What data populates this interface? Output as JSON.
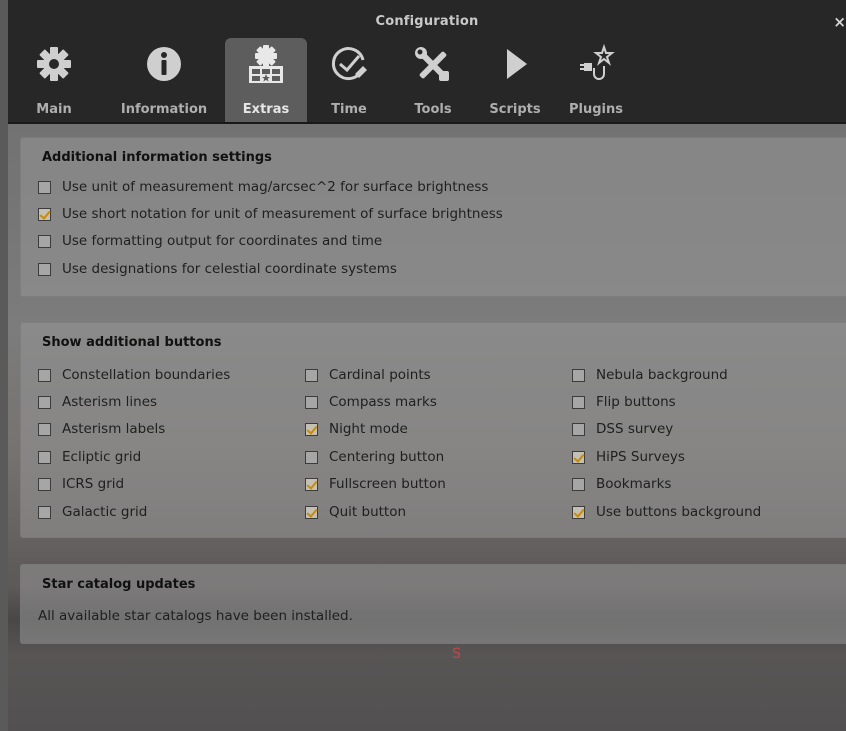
{
  "window": {
    "title": "Configuration",
    "close_label": "×"
  },
  "tabs": [
    {
      "label": "Main",
      "icon": "gear-icon",
      "active": false
    },
    {
      "label": "Information",
      "icon": "info-icon",
      "active": false
    },
    {
      "label": "Extras",
      "icon": "extras-icon",
      "active": true
    },
    {
      "label": "Time",
      "icon": "clock-icon",
      "active": false
    },
    {
      "label": "Tools",
      "icon": "tools-icon",
      "active": false
    },
    {
      "label": "Scripts",
      "icon": "play-icon",
      "active": false
    },
    {
      "label": "Plugins",
      "icon": "plugin-icon",
      "active": false
    }
  ],
  "additional_info": {
    "title": "Additional information settings",
    "options": [
      {
        "label": "Use unit of measurement mag/arcsec^2 for surface brightness",
        "checked": false
      },
      {
        "label": "Use short notation for unit of measurement of surface brightness",
        "checked": true
      },
      {
        "label": "Use formatting output for coordinates and time",
        "checked": false
      },
      {
        "label": "Use designations for celestial coordinate systems",
        "checked": false
      }
    ]
  },
  "buttons_group": {
    "title": "Show additional buttons",
    "col1": [
      {
        "label": "Constellation boundaries",
        "checked": false
      },
      {
        "label": "Asterism lines",
        "checked": false
      },
      {
        "label": "Asterism labels",
        "checked": false
      },
      {
        "label": "Ecliptic grid",
        "checked": false
      },
      {
        "label": "ICRS grid",
        "checked": false
      },
      {
        "label": "Galactic grid",
        "checked": false
      }
    ],
    "col2": [
      {
        "label": "Cardinal points",
        "checked": false
      },
      {
        "label": "Compass marks",
        "checked": false
      },
      {
        "label": "Night mode",
        "checked": true
      },
      {
        "label": "Centering button",
        "checked": false
      },
      {
        "label": "Fullscreen button",
        "checked": true
      },
      {
        "label": "Quit button",
        "checked": true
      }
    ],
    "col3": [
      {
        "label": "Nebula background",
        "checked": false
      },
      {
        "label": "Flip buttons",
        "checked": false
      },
      {
        "label": "DSS survey",
        "checked": false
      },
      {
        "label": "HiPS Surveys",
        "checked": true
      },
      {
        "label": "Bookmarks",
        "checked": false
      },
      {
        "label": "Use buttons background",
        "checked": true
      }
    ]
  },
  "star_catalog": {
    "title": "Star catalog updates",
    "message": "All available star catalogs have been installed."
  },
  "colors": {
    "accent_check": "#c98a06",
    "toolbar_bg": "#272727",
    "active_tab_bg": "#5d5d5d"
  }
}
